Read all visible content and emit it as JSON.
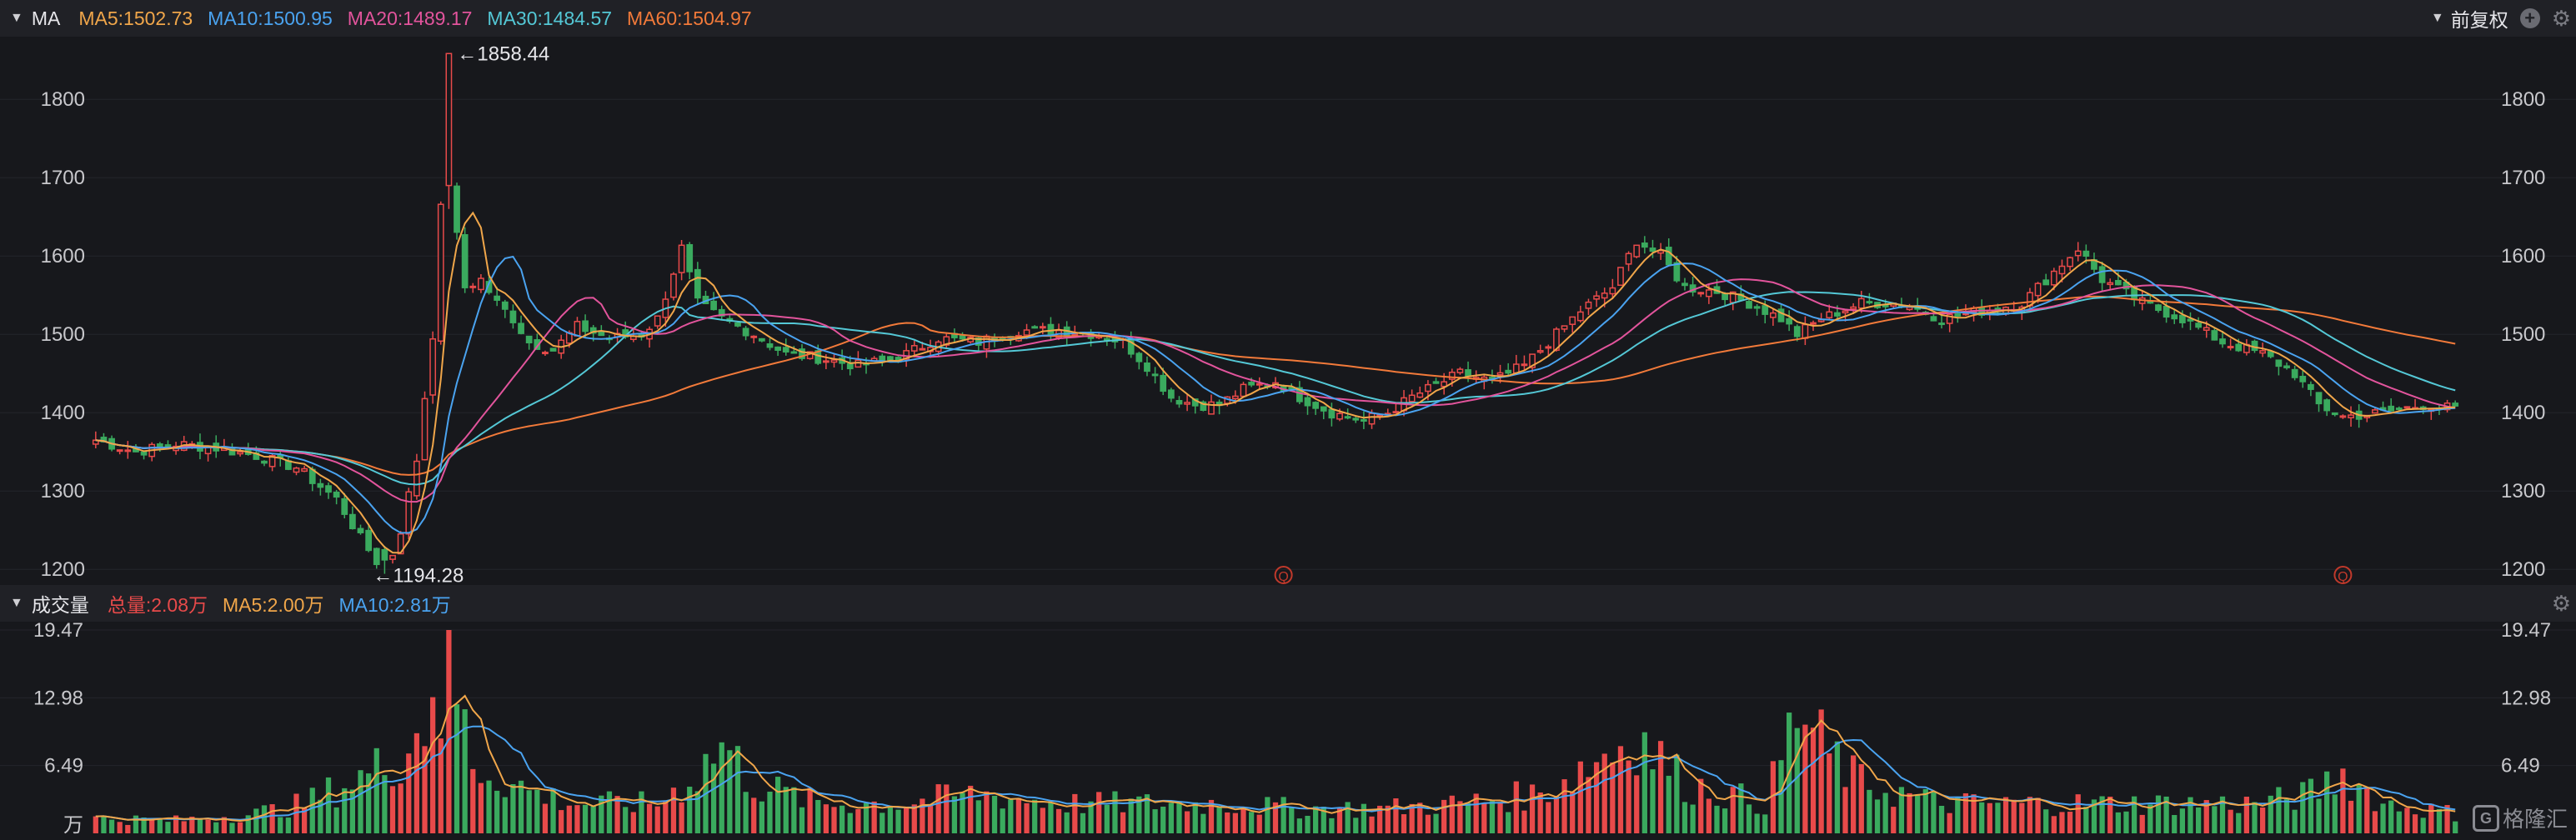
{
  "header": {
    "indicator": "MA",
    "legend": [
      {
        "label": "MA5:1502.73",
        "color": "#f0a64a"
      },
      {
        "label": "MA10:1500.95",
        "color": "#4aa3f0"
      },
      {
        "label": "MA20:1489.17",
        "color": "#e2549c"
      },
      {
        "label": "MA30:1484.57",
        "color": "#54c8d6"
      },
      {
        "label": "MA60:1504.97",
        "color": "#f27a3a"
      }
    ],
    "adjust_label": "前复权",
    "add_icon": "plus-circle-icon",
    "settings_icon": "gear-icon"
  },
  "price_axis": {
    "ticks": [
      "1800",
      "1700",
      "1600",
      "1500",
      "1400",
      "1300",
      "1200"
    ],
    "max_label": "←1858.44",
    "min_label": "←1194.28",
    "marker": "Q"
  },
  "volume": {
    "title": "成交量",
    "legend": [
      {
        "label": "总量:2.08万",
        "color": "#e84a4a"
      },
      {
        "label": "MA5:2.00万",
        "color": "#f0a64a"
      },
      {
        "label": "MA10:2.81万",
        "color": "#4aa3f0"
      }
    ],
    "ticks": [
      "19.47",
      "12.98",
      "6.49"
    ],
    "unit": "万"
  },
  "colors": {
    "up": "#e84a4a",
    "down": "#3aaa5e",
    "grid": "#24252b",
    "ma5": "#f0a64a",
    "ma10": "#4aa3f0",
    "ma20": "#e2549c",
    "ma30": "#54c8d6",
    "ma60": "#f27a3a"
  },
  "watermark": "格隆汇",
  "chart_data": {
    "type": "candlestick",
    "ylim": [
      1180,
      1880
    ],
    "anchors_close": [
      [
        0,
        1365
      ],
      [
        5,
        1350
      ],
      [
        10,
        1360
      ],
      [
        15,
        1355
      ],
      [
        20,
        1345
      ],
      [
        25,
        1330
      ],
      [
        30,
        1290
      ],
      [
        33,
        1240
      ],
      [
        35,
        1210
      ],
      [
        37,
        1220
      ],
      [
        38,
        1250
      ],
      [
        40,
        1340
      ],
      [
        42,
        1500
      ],
      [
        43,
        1660
      ],
      [
        44,
        1690
      ],
      [
        46,
        1560
      ],
      [
        48,
        1570
      ],
      [
        50,
        1540
      ],
      [
        52,
        1520
      ],
      [
        54,
        1490
      ],
      [
        57,
        1480
      ],
      [
        60,
        1510
      ],
      [
        64,
        1495
      ],
      [
        68,
        1500
      ],
      [
        70,
        1520
      ],
      [
        73,
        1610
      ],
      [
        75,
        1540
      ],
      [
        78,
        1520
      ],
      [
        82,
        1500
      ],
      [
        86,
        1475
      ],
      [
        90,
        1470
      ],
      [
        95,
        1460
      ],
      [
        100,
        1470
      ],
      [
        105,
        1495
      ],
      [
        110,
        1490
      ],
      [
        115,
        1505
      ],
      [
        120,
        1505
      ],
      [
        125,
        1500
      ],
      [
        128,
        1490
      ],
      [
        131,
        1460
      ],
      [
        134,
        1420
      ],
      [
        137,
        1410
      ],
      [
        140,
        1410
      ],
      [
        143,
        1430
      ],
      [
        147,
        1440
      ],
      [
        150,
        1420
      ],
      [
        154,
        1400
      ],
      [
        158,
        1390
      ],
      [
        161,
        1400
      ],
      [
        164,
        1420
      ],
      [
        167,
        1435
      ],
      [
        170,
        1450
      ],
      [
        174,
        1440
      ],
      [
        178,
        1460
      ],
      [
        181,
        1490
      ],
      [
        185,
        1530
      ],
      [
        189,
        1560
      ],
      [
        192,
        1620
      ],
      [
        195,
        1600
      ],
      [
        198,
        1560
      ],
      [
        202,
        1555
      ],
      [
        206,
        1540
      ],
      [
        210,
        1520
      ],
      [
        212,
        1500
      ],
      [
        215,
        1520
      ],
      [
        220,
        1540
      ],
      [
        225,
        1540
      ],
      [
        230,
        1520
      ],
      [
        235,
        1530
      ],
      [
        240,
        1540
      ],
      [
        244,
        1580
      ],
      [
        247,
        1610
      ],
      [
        250,
        1570
      ],
      [
        255,
        1540
      ],
      [
        260,
        1520
      ],
      [
        265,
        1490
      ],
      [
        270,
        1475
      ],
      [
        274,
        1450
      ],
      [
        277,
        1410
      ],
      [
        280,
        1395
      ],
      [
        285,
        1400
      ],
      [
        290,
        1410
      ],
      [
        294,
        1405
      ]
    ],
    "volume_anchors": [
      [
        0,
        1.5
      ],
      [
        10,
        1.3
      ],
      [
        20,
        2
      ],
      [
        26,
        3
      ],
      [
        30,
        4.5
      ],
      [
        34,
        6
      ],
      [
        38,
        8
      ],
      [
        41,
        11
      ],
      [
        42,
        17
      ],
      [
        43,
        12
      ],
      [
        44,
        19.47
      ],
      [
        45,
        14
      ],
      [
        47,
        7
      ],
      [
        52,
        5
      ],
      [
        55,
        4
      ],
      [
        60,
        3
      ],
      [
        70,
        3
      ],
      [
        75,
        6
      ],
      [
        78,
        9
      ],
      [
        82,
        5
      ],
      [
        90,
        3
      ],
      [
        100,
        3
      ],
      [
        110,
        4
      ],
      [
        120,
        3
      ],
      [
        130,
        3
      ],
      [
        140,
        3
      ],
      [
        150,
        2.5
      ],
      [
        160,
        2.5
      ],
      [
        170,
        3
      ],
      [
        180,
        4
      ],
      [
        192,
        10
      ],
      [
        198,
        5
      ],
      [
        208,
        3
      ],
      [
        212,
        12
      ],
      [
        216,
        8
      ],
      [
        220,
        5
      ],
      [
        230,
        3
      ],
      [
        240,
        3
      ],
      [
        250,
        3
      ],
      [
        260,
        3
      ],
      [
        270,
        3
      ],
      [
        276,
        4
      ],
      [
        280,
        6
      ],
      [
        285,
        3
      ],
      [
        294,
        2
      ]
    ],
    "volume_ylim": [
      0,
      19.47
    ],
    "count": 295
  }
}
